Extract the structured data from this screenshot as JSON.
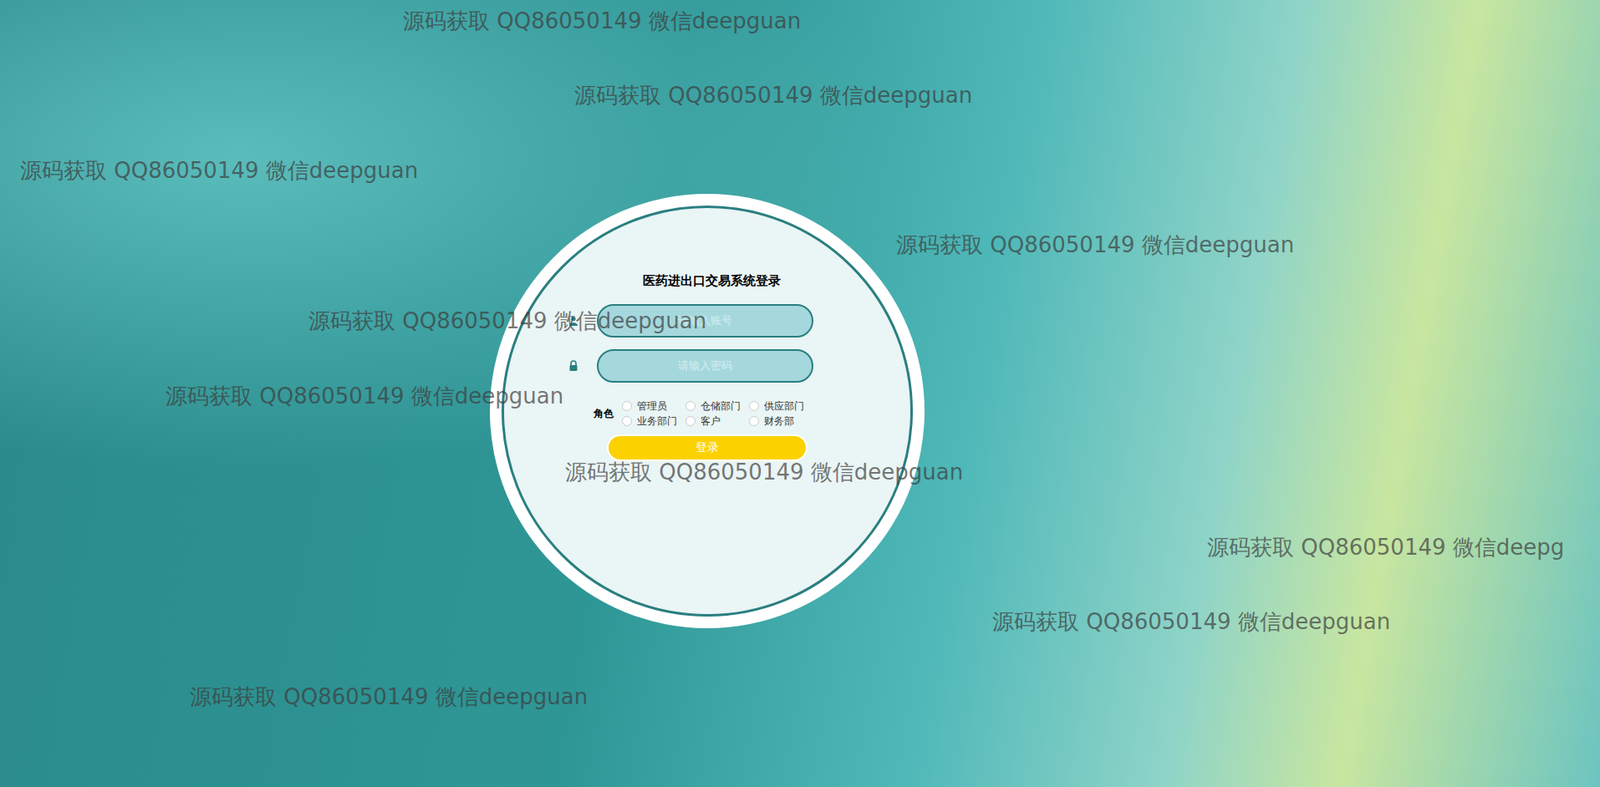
{
  "login": {
    "title": "医药进出口交易系统登录",
    "username": {
      "placeholder": "请输入账号"
    },
    "password": {
      "placeholder": "请输入密码"
    },
    "role_label": "角色",
    "roles": [
      {
        "label": "管理员",
        "selected": false
      },
      {
        "label": "仓储部门",
        "selected": false
      },
      {
        "label": "供应部门",
        "selected": false
      },
      {
        "label": "业务部门",
        "selected": false
      },
      {
        "label": "客户",
        "selected": false
      },
      {
        "label": "财务部",
        "selected": false
      }
    ],
    "submit": "登录"
  },
  "watermarks": [
    "源码获取 QQ86050149 微信deepguan",
    "源码获取 QQ86050149 微信deepguan",
    "源码获取 QQ86050149 微信deepguan",
    "源码获取 QQ86050149 微信deepguan",
    "源码获取 QQ86050149 微信deepguan",
    "源码获取 QQ86050149 微信deepguan",
    "源码获取 QQ86050149 微信deepguan",
    "源码获取 QQ86050149 微信deepg",
    "源码获取 QQ86050149 微信deepguan",
    "源码获取 QQ86050149 微信deepguan"
  ]
}
